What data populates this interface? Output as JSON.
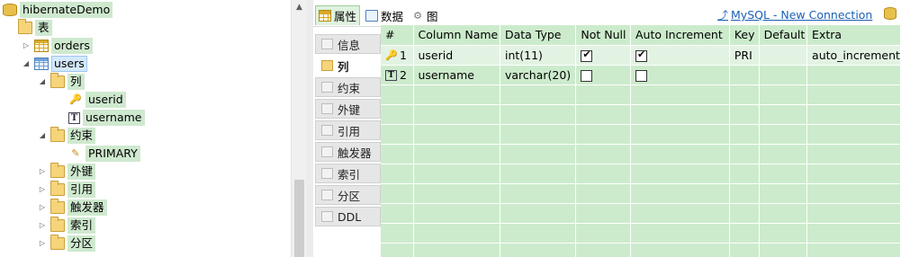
{
  "tree": {
    "database": "hibernateDemo",
    "tables_folder": "表",
    "table_orders": "orders",
    "table_users": "users",
    "columns_folder": "列",
    "columns": [
      "userid",
      "username"
    ],
    "constraints_folder": "约束",
    "constraint_primary": "PRIMARY",
    "other_folders": [
      "外键",
      "引用",
      "触发器",
      "索引",
      "分区"
    ]
  },
  "top_tabs": [
    {
      "label": "属性"
    },
    {
      "label": "数据"
    },
    {
      "label": "图"
    }
  ],
  "connection_link": "MySQL - New Connection",
  "side_tabs": [
    "信息",
    "列",
    "约束",
    "外键",
    "引用",
    "触发器",
    "索引",
    "分区",
    "DDL"
  ],
  "grid": {
    "headers": [
      "#",
      "Column Name",
      "Data Type",
      "Not Null",
      "Auto Increment",
      "Key",
      "Default",
      "Extra"
    ],
    "rows": [
      {
        "num": "1",
        "name": "userid",
        "type": "int(11)",
        "not_null": true,
        "auto_increment": true,
        "key": "PRI",
        "default": "",
        "extra": "auto_increment"
      },
      {
        "num": "2",
        "name": "username",
        "type": "varchar(20)",
        "not_null": false,
        "auto_increment": false,
        "key": "",
        "default": "",
        "extra": ""
      }
    ]
  }
}
